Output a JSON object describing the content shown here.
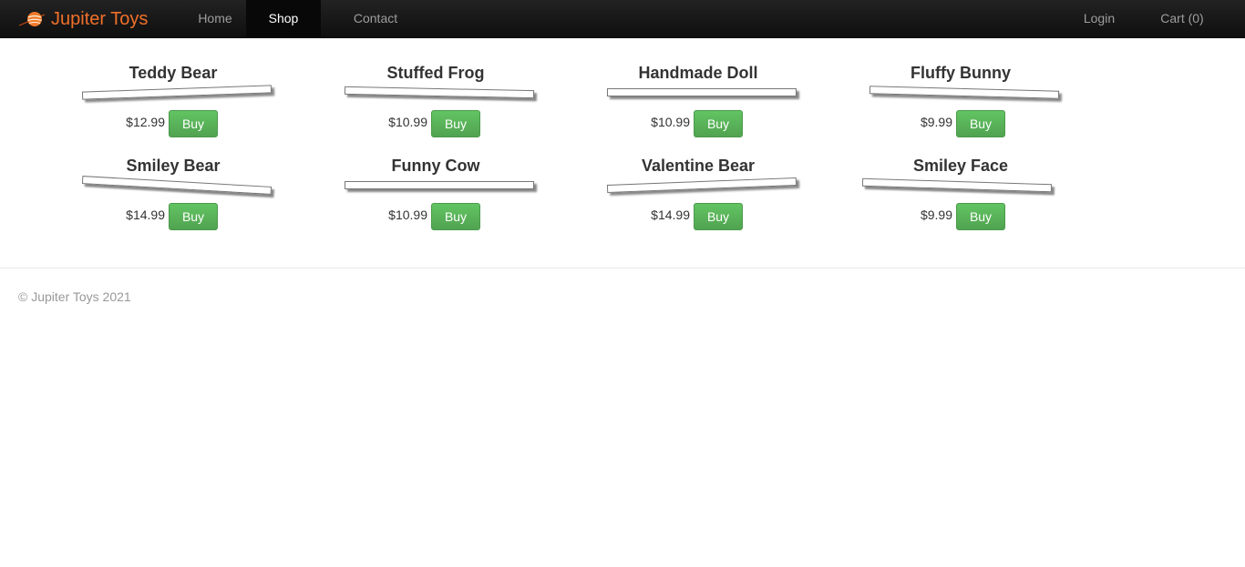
{
  "brand": {
    "name": "Jupiter Toys",
    "logo_icon": "planet-icon",
    "accent": "#f0702a"
  },
  "nav": {
    "home": "Home",
    "shop": "Shop",
    "contact": "Contact",
    "login": "Login",
    "cart": "Cart (0)",
    "active": "Shop"
  },
  "products": [
    {
      "title": "Teddy Bear",
      "price": "$12.99",
      "buy": "Buy"
    },
    {
      "title": "Stuffed Frog",
      "price": "$10.99",
      "buy": "Buy"
    },
    {
      "title": "Handmade Doll",
      "price": "$10.99",
      "buy": "Buy"
    },
    {
      "title": "Fluffy Bunny",
      "price": "$9.99",
      "buy": "Buy"
    },
    {
      "title": "Smiley Bear",
      "price": "$14.99",
      "buy": "Buy"
    },
    {
      "title": "Funny Cow",
      "price": "$10.99",
      "buy": "Buy"
    },
    {
      "title": "Valentine Bear",
      "price": "$14.99",
      "buy": "Buy"
    },
    {
      "title": "Smiley Face",
      "price": "$9.99",
      "buy": "Buy"
    }
  ],
  "footer": {
    "copyright": "© Jupiter Toys 2021"
  },
  "colors": {
    "buy_button": "#51a351",
    "navbar": "#1b1b1b"
  }
}
